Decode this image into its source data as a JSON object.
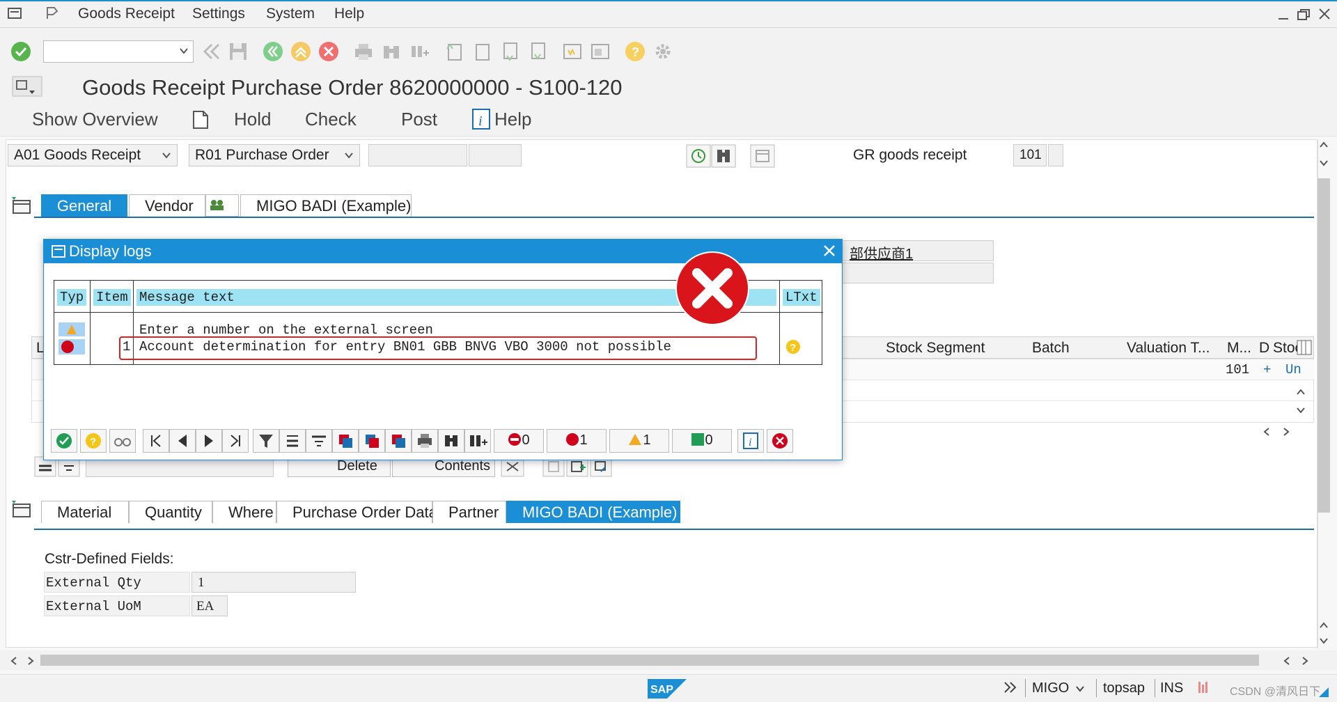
{
  "menu": {
    "items": [
      "Goods Receipt",
      "Settings",
      "System",
      "Help"
    ]
  },
  "toolbar": {
    "command_value": "",
    "icons": [
      "enter-icon",
      "back-icon",
      "save-icon",
      "back-green-icon",
      "exit-icon",
      "cancel-icon",
      "print-icon",
      "find-icon",
      "find-next-icon",
      "first-page-icon",
      "prev-page-icon",
      "next-page-icon",
      "last-page-icon",
      "new-session-icon",
      "shortcut-icon",
      "help-icon",
      "settings-icon"
    ]
  },
  "title": "Goods Receipt Purchase Order 8620000000 - S100-120",
  "app_toolbar": {
    "show_overview": "Show Overview",
    "hold": "Hold",
    "check": "Check",
    "post": "Post",
    "help": "Help"
  },
  "header": {
    "action": "A01 Goods Receipt",
    "reference": "R01 Purchase Order",
    "gr_label": "GR goods receipt",
    "movement_type": "101"
  },
  "header_tabs": [
    "General",
    "Vendor",
    "MIGO BADI (Example)"
  ],
  "vendor_fragment": "部供应商1",
  "item_columns": {
    "l": "L",
    "stock_segment": "Stock Segment",
    "batch": "Batch",
    "valuation": "Valuation T...",
    "m": "M...",
    "d": "D",
    "stoc": "Stoc"
  },
  "item_row": {
    "movement": "101",
    "plus": "+",
    "un": "Un"
  },
  "behind_buttons": {
    "delete": "Delete",
    "contents": "Contents"
  },
  "detail_tabs": [
    "Material",
    "Quantity",
    "Where",
    "Purchase Order Data",
    "Partner",
    "MIGO BADI (Example)"
  ],
  "badi": {
    "section_label": "Cstr-Defined Fields:",
    "ext_qty_label": "External Qty",
    "ext_qty_value": "1",
    "ext_uom_label": "External UoM",
    "ext_uom_value": "EA"
  },
  "dialog": {
    "title": "Display logs",
    "columns": {
      "typ": "Typ",
      "item": "Item",
      "message": "Message text",
      "ltxt": "LTxt"
    },
    "rows": [
      {
        "type": "warning",
        "item": "",
        "message": "Enter a number on the external screen"
      },
      {
        "type": "error",
        "item": "1",
        "message": "Account determination for entry BN01 GBB BNVG VBO 3000 not possible"
      }
    ],
    "counts": {
      "stop": "0",
      "error": "1",
      "warning": "1",
      "success": "0"
    }
  },
  "statusbar": {
    "brand": "SAP",
    "transaction": "MIGO",
    "server": "topsap",
    "mode": "INS",
    "watermark": "CSDN @清风日下"
  },
  "colors": {
    "accent": "#1a8fd6",
    "error": "#d0021b",
    "warning": "#f5a623",
    "success": "#1f9d55",
    "highlight_box": "#e02020"
  }
}
